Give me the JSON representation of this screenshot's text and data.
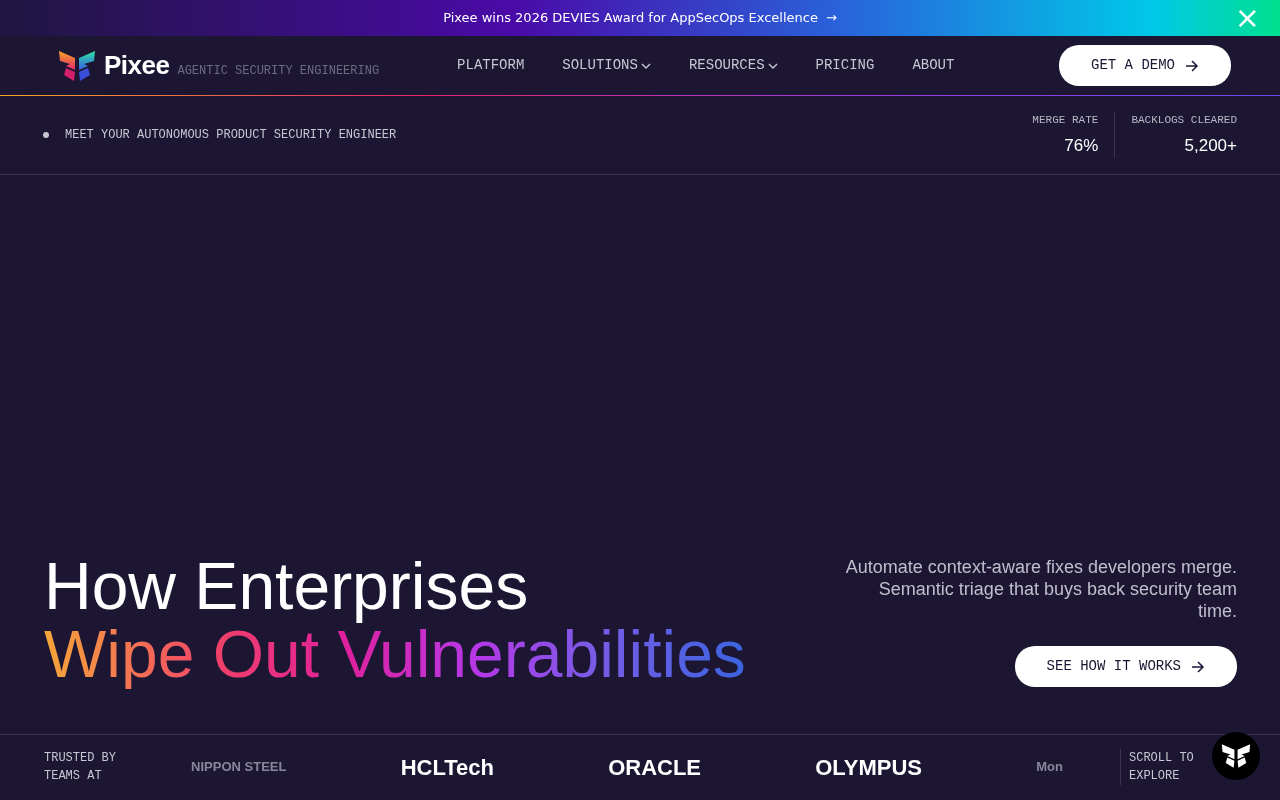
{
  "announcement": {
    "text": "Pixee wins 2026 DEVIES Award for AppSecOps Excellence",
    "arrow": "→",
    "close": "×"
  },
  "header": {
    "brand": "Pixee",
    "tagline": "AGENTIC SECURITY ENGINEERING",
    "nav": [
      {
        "label": "PLATFORM",
        "dropdown": false
      },
      {
        "label": "SOLUTIONS",
        "dropdown": true
      },
      {
        "label": "RESOURCES",
        "dropdown": true
      },
      {
        "label": "PRICING",
        "dropdown": false
      },
      {
        "label": "ABOUT",
        "dropdown": false
      }
    ],
    "cta": "GET A DEMO"
  },
  "stats_bar": {
    "eyebrow": "MEET YOUR AUTONOMOUS PRODUCT SECURITY ENGINEER",
    "stats": [
      {
        "label": "MERGE RATE",
        "value": "76%"
      },
      {
        "label": "BACKLOGS CLEARED",
        "value": "5,200+"
      }
    ]
  },
  "hero": {
    "title_line_1": "How Enterprises",
    "title_line_2": "Wipe Out Vulnerabilities",
    "description": "Automate context-aware fixes developers merge. Semantic triage that buys back security team time.",
    "button": "SEE HOW IT WORKS"
  },
  "trusted": {
    "label": "TRUSTED BY TEAMS AT",
    "logos": [
      {
        "name": "NIPPON STEEL",
        "faded": true
      },
      {
        "name": "HCLTech",
        "faded": false
      },
      {
        "name": "ORACLE",
        "faded": false
      },
      {
        "name": "OLYMPUS",
        "faded": false
      },
      {
        "name": "Mon",
        "faded": true
      }
    ],
    "scroll_hint": "SCROLL TO EXPLORE"
  }
}
